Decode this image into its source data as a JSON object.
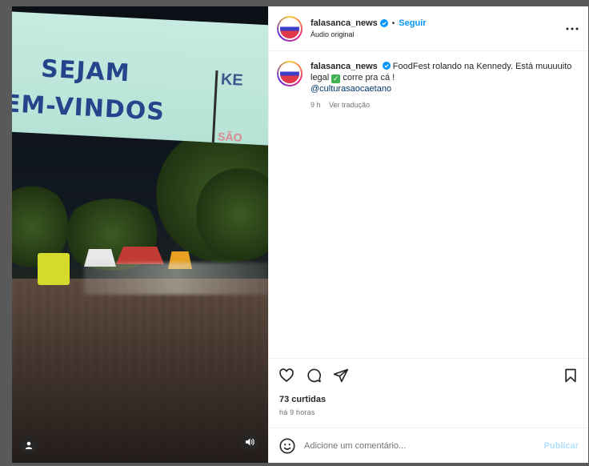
{
  "post": {
    "username": "falasanca_news",
    "follow_label": "Seguir",
    "audio": "Áudio original",
    "caption": {
      "username": "falasanca_news",
      "text_1": "FoodFest rolando na Kennedy. Está muuuuito legal",
      "text_2": "corre pra cá !",
      "mention": "@culturasaocaetano",
      "time": "9 h",
      "translate": "Ver tradução"
    },
    "likes": "73 curtidas",
    "ago": "há 9 horas",
    "comment_placeholder": "Adicione um comentário...",
    "post_label": "Publicar"
  },
  "media": {
    "banner_line1": "SEJAM",
    "banner_line2": "EM-VINDOS",
    "banner_logo_top": "KE",
    "banner_logo_bottom": "SÃO"
  },
  "icons": {
    "more": "more-options-icon",
    "like": "heart-icon",
    "comment": "comment-icon",
    "share": "share-icon",
    "save": "bookmark-icon",
    "emoji": "emoji-icon",
    "user": "user-tag-icon",
    "sound": "sound-icon",
    "verified": "verified-icon"
  },
  "colors": {
    "accent": "#0095f6",
    "verified": "#0095f6",
    "text": "#262626",
    "muted": "#737373",
    "post_disabled": "#b2dffc"
  }
}
